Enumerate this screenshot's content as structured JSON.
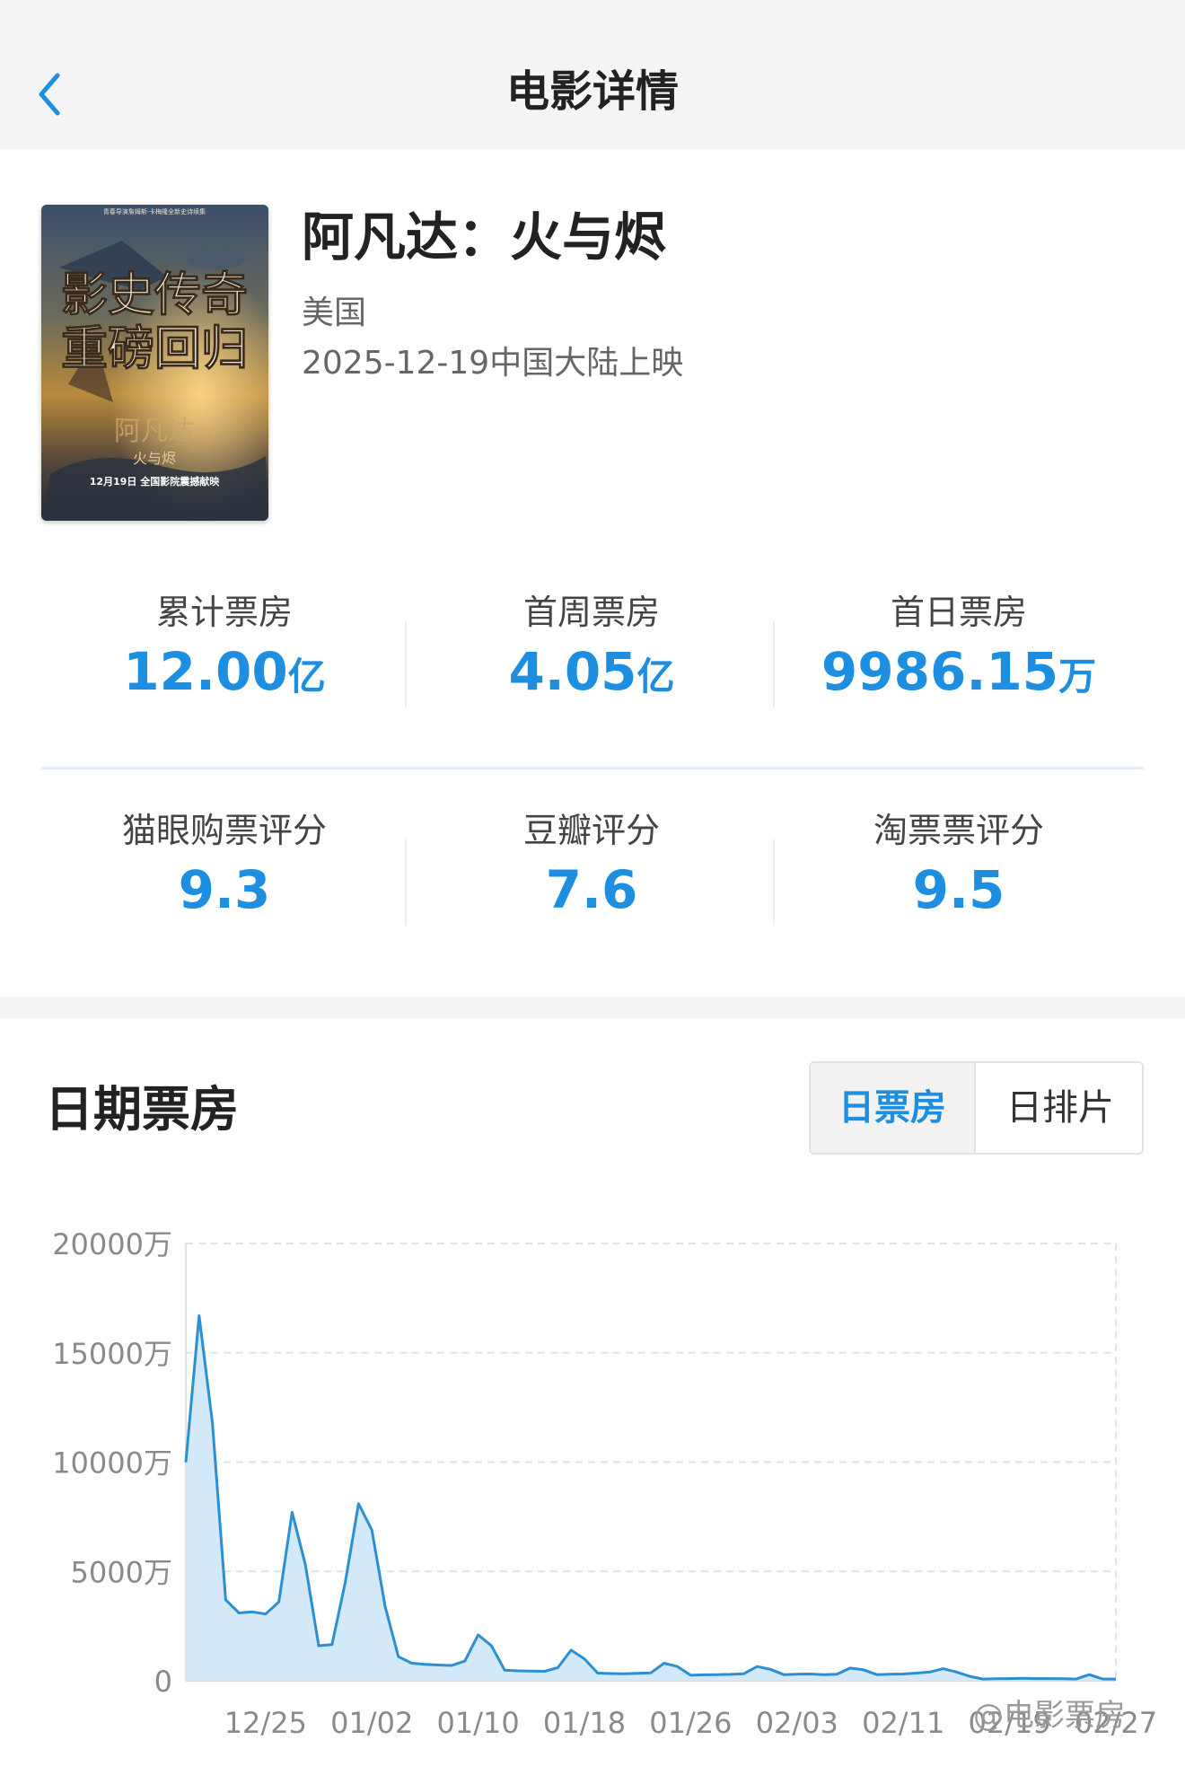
{
  "nav": {
    "title": "电影详情",
    "back_icon": "chevron-left-icon"
  },
  "movie": {
    "title": "阿凡达：火与烬",
    "country": "美国",
    "release": "2025-12-19中国大陆上映",
    "poster": {
      "top_line": "青春导演詹姆斯·卡梅隆全新史诗续集",
      "headline1": "影史传奇",
      "headline2": "重磅回归",
      "cn_title": "阿凡达",
      "cn_subtitle": "火与烬",
      "date_line": "12月19日 全国影院震撼献映"
    }
  },
  "stats": [
    {
      "label": "累计票房",
      "value": "12.00",
      "unit": "亿"
    },
    {
      "label": "首周票房",
      "value": "4.05",
      "unit": "亿"
    },
    {
      "label": "首日票房",
      "value": "9986.15",
      "unit": "万"
    }
  ],
  "ratings": [
    {
      "label": "猫眼购票评分",
      "value": "9.3"
    },
    {
      "label": "豆瓣评分",
      "value": "7.6"
    },
    {
      "label": "淘票票评分",
      "value": "9.5"
    }
  ],
  "section": {
    "title": "日期票房",
    "tabs": [
      {
        "label": "日票房",
        "active": true
      },
      {
        "label": "日排片",
        "active": false
      }
    ]
  },
  "chart_data": {
    "type": "area",
    "ylim": [
      0,
      20000
    ],
    "y_ticks": [
      "0",
      "5000万",
      "10000万",
      "15000万",
      "20000万"
    ],
    "y_tick_values": [
      0,
      5000,
      10000,
      15000,
      20000
    ],
    "x_tick_labels": [
      "12/25",
      "01/02",
      "01/10",
      "01/18",
      "01/26",
      "02/03",
      "02/11",
      "02/19",
      "02/27"
    ],
    "x_tick_index": [
      6,
      14,
      22,
      30,
      38,
      46,
      54,
      62,
      70
    ],
    "series": [
      {
        "values": [
          9986,
          16700,
          11800,
          3700,
          3100,
          3150,
          3050,
          3600,
          7700,
          5300,
          1600,
          1650,
          4500,
          8100,
          6900,
          3400,
          1100,
          800,
          750,
          720,
          700,
          900,
          2100,
          1600,
          480,
          450,
          440,
          430,
          600,
          1400,
          1000,
          350,
          330,
          320,
          340,
          360,
          800,
          650,
          250,
          270,
          280,
          290,
          320,
          650,
          520,
          280,
          300,
          310,
          280,
          300,
          580,
          500,
          280,
          300,
          310,
          350,
          400,
          550,
          400,
          200,
          80,
          90,
          100,
          110,
          100,
          100,
          90,
          80,
          280,
          80,
          80
        ]
      }
    ],
    "grid": "horizontal-dashed",
    "line_color": "#2a8fd4",
    "fill_color": "#d3e8f8"
  },
  "watermark": "@电影票房",
  "colors": {
    "accent": "#1e8ee0",
    "background": "#f5f5f7"
  }
}
